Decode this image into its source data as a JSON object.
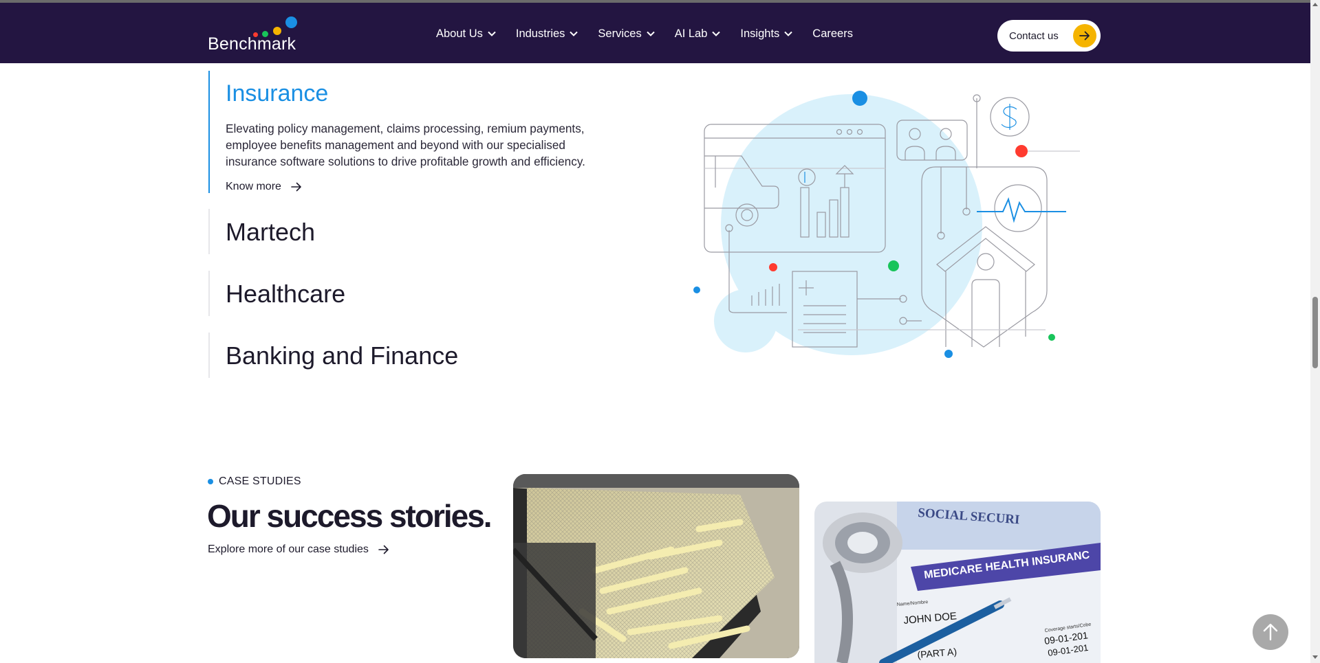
{
  "brand": {
    "name": "Benchmark",
    "dot_colors": [
      "#ff3b2f",
      "#18c45a",
      "#f5b400",
      "#1a8fe3"
    ]
  },
  "nav": {
    "items": [
      {
        "label": "About Us",
        "has_dropdown": true
      },
      {
        "label": "Industries",
        "has_dropdown": true
      },
      {
        "label": "Services",
        "has_dropdown": true
      },
      {
        "label": "AI Lab",
        "has_dropdown": true
      },
      {
        "label": "Insights",
        "has_dropdown": true
      },
      {
        "label": "Careers",
        "has_dropdown": false
      }
    ],
    "contact_label": "Contact us"
  },
  "industries": {
    "active": {
      "title": "Insurance",
      "description": "Elevating policy management, claims processing, remium payments, employee benefits management and beyond with our specialised insurance software solutions to drive profitable growth and efficiency.",
      "link_label": "Know more"
    },
    "others": [
      "Martech",
      "Healthcare",
      "Banking and Finance"
    ]
  },
  "case_studies": {
    "tag": "CASE STUDIES",
    "title": "Our success stories.",
    "link_label": "Explore more of our case studies",
    "cards": [
      {
        "image": "french-fries-deep-fryer"
      },
      {
        "image": "medicare-card-stethoscope",
        "visible_text": {
          "line1": "SOCIAL SECURI",
          "line2": "MEDICARE HEALTH INSURANC",
          "name_label": "Name/Nombre",
          "name": "JOHN DOE",
          "part": "(PART A)",
          "coverage": "Coverage starts/Cobe",
          "date1": "09-01-201",
          "date2": "09-01-201"
        }
      }
    ]
  },
  "colors": {
    "nav_bg": "#231541",
    "accent_blue": "#1a8fe3",
    "accent_yellow": "#f5b400",
    "accent_red": "#ff3b2f",
    "accent_green": "#18c45a",
    "illustration_fill": "#d9f1fb"
  },
  "icons": {
    "nav_dropdown": "chevron-down-icon",
    "link_arrow": "arrow-right-icon",
    "scroll_top": "arrow-up-icon"
  }
}
